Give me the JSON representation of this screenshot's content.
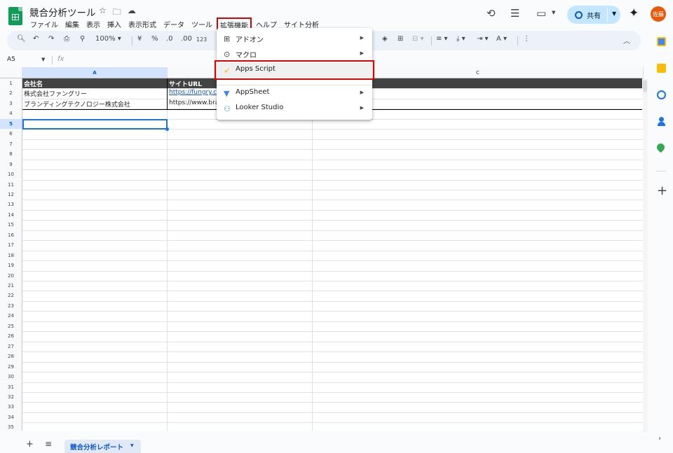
{
  "header": {
    "doc_title": "競合分析ツール",
    "menu": [
      "ファイル",
      "編集",
      "表示",
      "挿入",
      "表示形式",
      "データ",
      "ツール",
      "拡張機能",
      "ヘルプ",
      "サイト分析"
    ],
    "share_label": "共有",
    "avatar_text": "佐藤"
  },
  "toolbar": {
    "zoom": "100%",
    "currency": "¥",
    "percent": "%",
    "dec_decrease": ".0",
    "dec_increase": ".00",
    "number_format": "123"
  },
  "formula_bar": {
    "name_box": "A5",
    "fx": "fx"
  },
  "columns": [
    "A",
    "B",
    "C"
  ],
  "rows": [
    "1",
    "2",
    "3",
    "4",
    "5",
    "6",
    "7",
    "8",
    "9",
    "10",
    "11",
    "12",
    "13",
    "14",
    "15",
    "16",
    "17",
    "18",
    "19",
    "20",
    "21",
    "22",
    "23",
    "24",
    "25",
    "26",
    "27",
    "28",
    "29",
    "30",
    "31",
    "32",
    "33",
    "34",
    "35"
  ],
  "cells": {
    "a1": "会社名",
    "b1": "サイトURL",
    "a2": "株式会社ファングリー",
    "b2": "https://fungry.co",
    "a3": "ブランディングテクノロジー株式会社",
    "b3": "https://www.bran"
  },
  "extensions_menu": {
    "items": [
      {
        "label": "アドオン",
        "icon": "addon-icon",
        "submenu": true
      },
      {
        "label": "マクロ",
        "icon": "macro-icon",
        "submenu": true
      },
      {
        "label": "Apps Script",
        "icon": "apps-script-icon",
        "submenu": false
      },
      {
        "label": "AppSheet",
        "icon": "appsheet-icon",
        "submenu": true
      },
      {
        "label": "Looker Studio",
        "icon": "looker-studio-icon",
        "submenu": true
      }
    ]
  },
  "sheet_tabs": [
    {
      "label": "競合分析レポート",
      "active": true
    }
  ],
  "colors": {
    "accent": "#0b57d0",
    "highlight_box": "#e00000",
    "header_row": "#434343",
    "sheets_green": "#0f9d58"
  }
}
